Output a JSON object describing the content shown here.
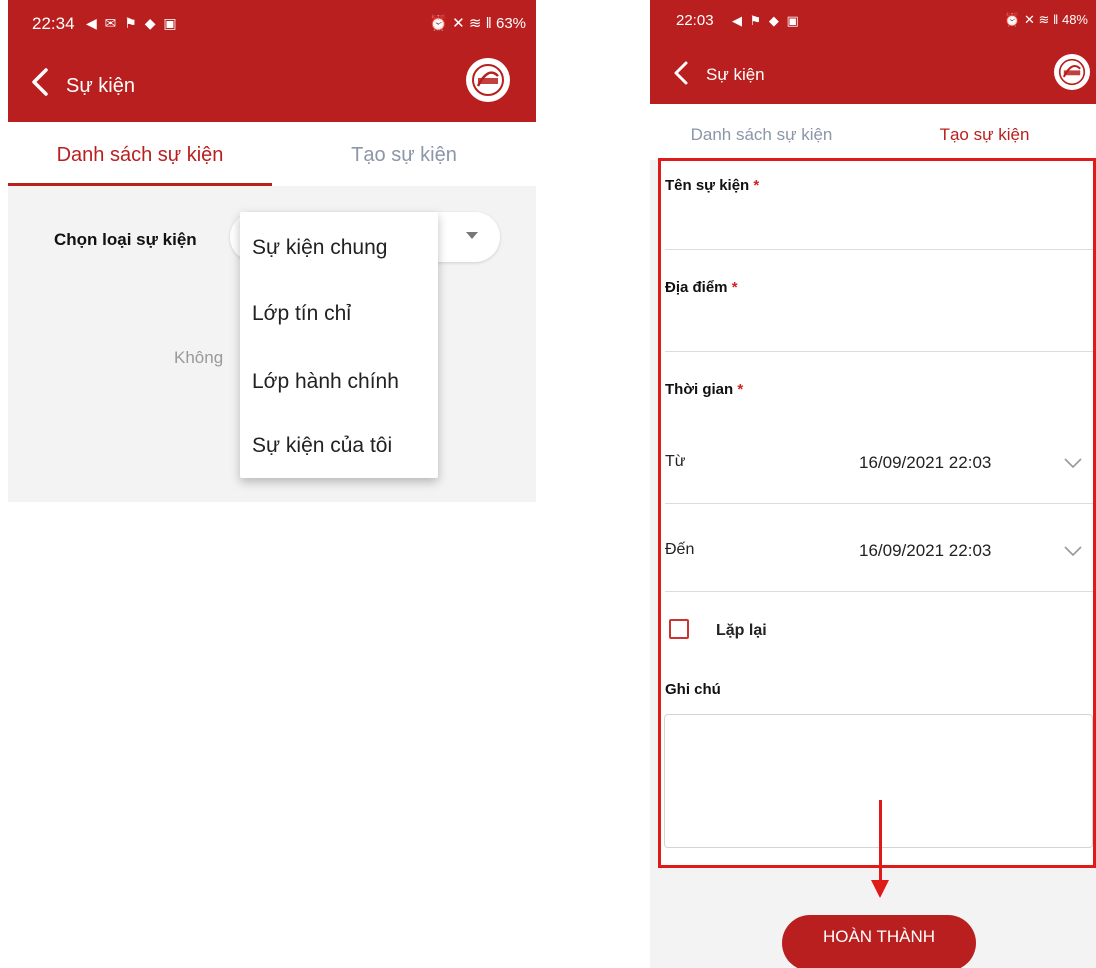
{
  "left_screen": {
    "status": {
      "time": "22:34",
      "icons": "◀ ✉ ⚑ ◆ ▣",
      "right": "⏰ ✕ ≋ ‖ 63%"
    },
    "appbar": {
      "title": "Sự kiện"
    },
    "tabs": [
      {
        "label": "Danh sách sự kiện",
        "active": true
      },
      {
        "label": "Tạo sự kiện",
        "active": false
      }
    ],
    "chooser": {
      "label": "Chọn loại sự kiện"
    },
    "empty_text": "Không",
    "dropdown": {
      "options": [
        "Sự kiện chung",
        "Lớp tín chỉ",
        "Lớp hành chính",
        "Sự kiện của tôi"
      ]
    }
  },
  "right_screen": {
    "status": {
      "time": "22:03",
      "icons": "◀ ⚑ ◆ ▣",
      "right": "⏰ ✕ ≋ ‖ 48%"
    },
    "appbar": {
      "title": "Sự kiện"
    },
    "tabs": [
      {
        "label": "Danh sách sự kiện",
        "active": false
      },
      {
        "label": "Tạo sự kiện",
        "active": true
      }
    ],
    "form": {
      "event_name_label": "Tên sự kiện",
      "location_label": "Địa điểm",
      "time_label": "Thời gian",
      "required_mark": "*",
      "from_label": "Từ",
      "from_value": "16/09/2021 22:03",
      "to_label": "Đến",
      "to_value": "16/09/2021 22:03",
      "repeat_label": "Lặp lại",
      "repeat_checked": false,
      "note_label": "Ghi chú"
    },
    "submit_label": "HOÀN THÀNH"
  },
  "colors": {
    "brand_red": "#b91f1f",
    "highlight_red": "#e01919",
    "inactive_tab": "#8b96a8"
  }
}
